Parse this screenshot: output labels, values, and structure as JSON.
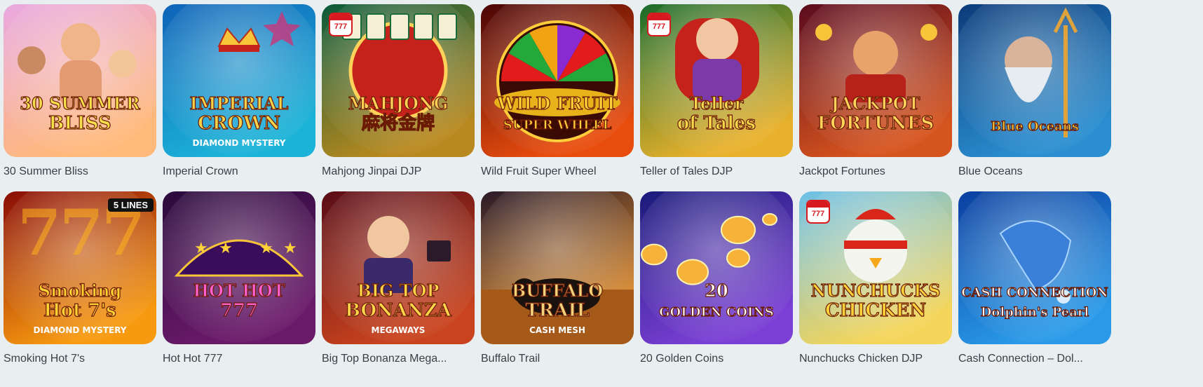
{
  "games": [
    {
      "name": "30 Summer Bliss",
      "logo": "30 SUMMER",
      "logo2": "BLISS",
      "icon": "beach-icon",
      "bg": [
        "#e9a8e0",
        "#ffb97a"
      ],
      "logo_color": "#f6e04a"
    },
    {
      "name": "Imperial Crown",
      "logo": "IMPERIAL",
      "logo2": "CROWN",
      "sub": "DIAMOND MYSTERY",
      "icon": "crown-icon",
      "bg": [
        "#0f63b8",
        "#1cb3d8"
      ],
      "logo_color": "#f7d24a"
    },
    {
      "name": "Mahjong Jinpai DJP",
      "logo": "MAHJONG",
      "logo2": "麻将金牌",
      "icon": "mahjong-icon",
      "bg": [
        "#0a5a3a",
        "#b8891f"
      ],
      "logo_color": "#ffd257",
      "badge": "777"
    },
    {
      "name": "Wild Fruit Super Wheel",
      "logo": "WILD FRUIT",
      "logo2": "SUPER WHEEL",
      "icon": "wheel-icon",
      "bg": [
        "#4a0505",
        "#e84d0e"
      ],
      "logo_color": "#ffd23a"
    },
    {
      "name": "Teller of Tales DJP",
      "logo": "Teller",
      "logo2": "of Tales",
      "icon": "storyteller-icon",
      "bg": [
        "#186b2a",
        "#e8b12c"
      ],
      "logo_color": "#f3d84b",
      "badge": "777"
    },
    {
      "name": "Jackpot Fortunes",
      "logo": "JACKPOT",
      "logo2": "FORTUNES",
      "icon": "fortune-god-icon",
      "bg": [
        "#5b0b1e",
        "#d6541e"
      ],
      "logo_color": "#ffd25a"
    },
    {
      "name": "Blue Oceans",
      "logo": "Blue Oceans",
      "logo2": "",
      "icon": "poseidon-icon",
      "bg": [
        "#0b3b7a",
        "#2a8ed0"
      ],
      "logo_color": "#f7c83a"
    },
    {
      "name": "Smoking Hot 7's",
      "logo": "Smoking",
      "logo2": "Hot 7's",
      "sub": "DIAMOND MYSTERY",
      "lines": "5 LINES",
      "icon": "seven-icon",
      "bg": [
        "#8a0c05",
        "#f79a10"
      ],
      "logo_color": "#ffd233"
    },
    {
      "name": "Hot Hot 777",
      "logo": "HOT HOT",
      "logo2": "777",
      "icon": "stage-icon",
      "bg": [
        "#2a0a3c",
        "#6b1a6a"
      ],
      "logo_color": "#ff5fcf"
    },
    {
      "name": "Big Top Bonanza Mega...",
      "logo": "BIG TOP",
      "logo2": "BONANZA",
      "sub": "MEGAWAYS",
      "icon": "ringmaster-icon",
      "bg": [
        "#5a0d16",
        "#c8431e"
      ],
      "logo_color": "#ffd64a"
    },
    {
      "name": "Buffalo Trail",
      "logo": "BUFFALO",
      "logo2": "TRAIL",
      "sub": "CASH MESH",
      "icon": "buffalo-icon",
      "bg": [
        "#2a1a28",
        "#e8912a"
      ],
      "logo_color": "#f0d37a"
    },
    {
      "name": "20 Golden Coins",
      "logo": "20",
      "logo2": "GOLDEN COINS",
      "icon": "coins-icon",
      "bg": [
        "#1a1b7a",
        "#7a3fd4"
      ],
      "logo_color": "#ffffff"
    },
    {
      "name": "Nunchucks Chicken DJP",
      "logo": "NUNCHUCKS",
      "logo2": "CHICKEN",
      "icon": "chicken-icon",
      "bg": [
        "#6cc0e8",
        "#f4d55a"
      ],
      "logo_color": "#ffd23a",
      "badge": "777"
    },
    {
      "name": "Cash Connection – Dol...",
      "logo": "CASH CONNECTION",
      "logo2": "Dolphin's Pearl",
      "icon": "dolphin-icon",
      "bg": [
        "#0a3fa0",
        "#2a9ae8"
      ],
      "logo_color": "#ffffff"
    }
  ]
}
